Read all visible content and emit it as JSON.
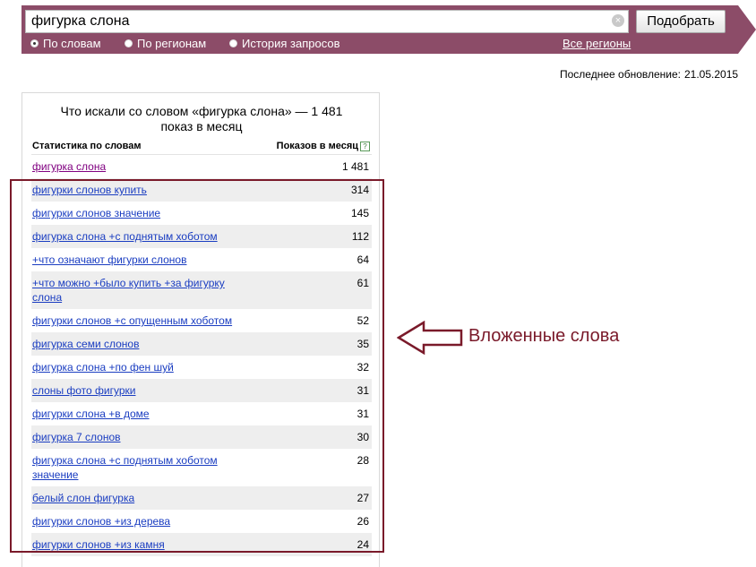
{
  "search": {
    "query": "фигурка слона",
    "button_label": "Подобрать",
    "clear_icon": "×",
    "modes": [
      {
        "label": "По словам",
        "selected": true
      },
      {
        "label": "По регионам",
        "selected": false
      },
      {
        "label": "История запросов",
        "selected": false
      }
    ],
    "regions_link": "Все регионы",
    "bar_color": "#8c4c68"
  },
  "last_update": {
    "label": "Последнее обновление:",
    "date": "21.05.2015"
  },
  "panel": {
    "title": "Что искали со словом «фигурка слона» — 1 481 показ в месяц",
    "col_left": "Статистика по словам",
    "col_right": "Показов в месяц",
    "help_icon": "?",
    "rows": [
      {
        "keyword": "фигурка слона",
        "count": "1 481"
      },
      {
        "keyword": "фигурки слонов купить",
        "count": "314"
      },
      {
        "keyword": "фигурки слонов значение",
        "count": "145"
      },
      {
        "keyword": "фигурка слона +с поднятым хоботом",
        "count": "112"
      },
      {
        "keyword": "+что означают фигурки слонов",
        "count": "64"
      },
      {
        "keyword": "+что можно +было купить +за фигурку слона",
        "count": "61"
      },
      {
        "keyword": "фигурки слонов +с опущенным хоботом",
        "count": "52"
      },
      {
        "keyword": "фигурка семи слонов",
        "count": "35"
      },
      {
        "keyword": "фигурка слона +по фен шуй",
        "count": "32"
      },
      {
        "keyword": "слоны фото фигурки",
        "count": "31"
      },
      {
        "keyword": "фигурки слона +в доме",
        "count": "31"
      },
      {
        "keyword": "фигурка 7 слонов",
        "count": "30"
      },
      {
        "keyword": "фигурка слона +с поднятым хоботом значение",
        "count": "28"
      },
      {
        "keyword": "белый слон фигурка",
        "count": "27"
      },
      {
        "keyword": "фигурки слонов +из дерева",
        "count": "26"
      },
      {
        "keyword": "фигурки слонов +из камня",
        "count": "24"
      }
    ]
  },
  "annotation": {
    "label": "Вложенные слова",
    "color": "#7a1a2a",
    "icon": "left-arrow-icon"
  }
}
